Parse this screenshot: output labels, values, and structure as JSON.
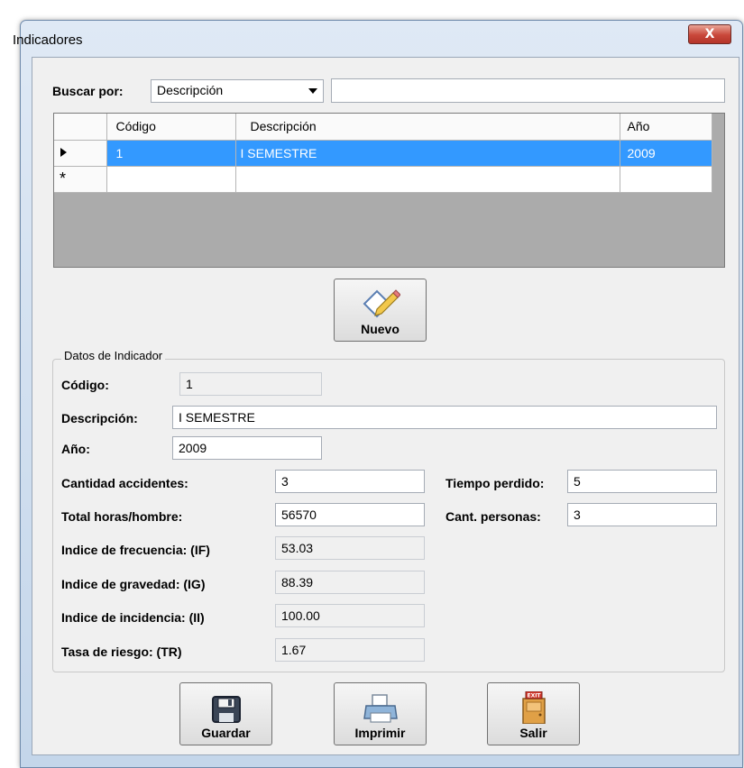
{
  "window": {
    "title": "Indicadores",
    "close_label": "X"
  },
  "search": {
    "label": "Buscar por:",
    "selected_option": "Descripción",
    "value": ""
  },
  "grid": {
    "columns": [
      "Código",
      "Descripción",
      "Año"
    ],
    "rows": [
      {
        "codigo": "1",
        "descripcion": "I SEMESTRE",
        "anio": "2009"
      }
    ],
    "new_row_marker": "*"
  },
  "buttons": {
    "nuevo": "Nuevo",
    "guardar": "Guardar",
    "imprimir": "Imprimir",
    "salir": "Salir",
    "exit_sign": "EXIT"
  },
  "datos": {
    "legend": "Datos de Indicador",
    "codigo_label": "Código:",
    "codigo_value": "1",
    "descripcion_label": "Descripción:",
    "descripcion_value": "I SEMESTRE",
    "anio_label": "Año:",
    "anio_value": "2009",
    "cant_acc_label": "Cantidad accidentes:",
    "cant_acc_value": "3",
    "tiempo_label": "Tiempo perdido:",
    "tiempo_value": "5",
    "horas_label": "Total horas/hombre:",
    "horas_value": "56570",
    "personas_label": "Cant. personas:",
    "personas_value": "3",
    "if_label": "Indice de frecuencia: (IF)",
    "if_value": "53.03",
    "ig_label": "Indice de gravedad: (IG)",
    "ig_value": "88.39",
    "ii_label": "Indice de incidencia: (II)",
    "ii_value": "100.00",
    "tr_label": "Tasa de riesgo: (TR)",
    "tr_value": "1.67"
  },
  "colors": {
    "selection": "#3399ff",
    "close": "#c8473a",
    "grid_bg": "#ababab"
  }
}
